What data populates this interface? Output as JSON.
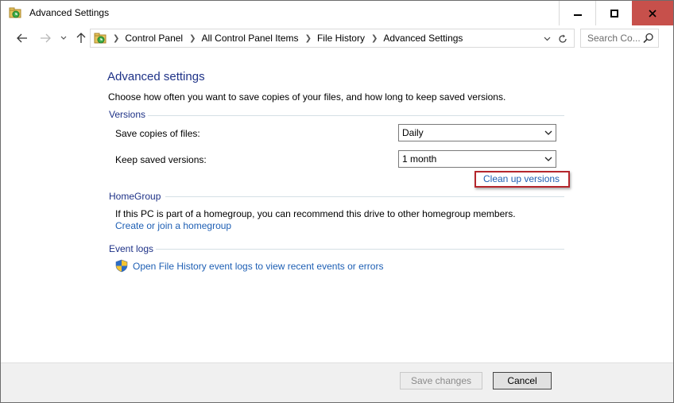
{
  "window": {
    "title": "Advanced Settings"
  },
  "address_bar": {
    "crumbs": [
      "Control Panel",
      "All Control Panel Items",
      "File History",
      "Advanced Settings"
    ]
  },
  "search": {
    "placeholder": "Search Co..."
  },
  "main": {
    "heading": "Advanced settings",
    "description": "Choose how often you want to save copies of your files, and how long to keep saved versions.",
    "versions": {
      "label": "Versions",
      "save_copies_label": "Save copies of files:",
      "save_copies_value": "Daily",
      "keep_versions_label": "Keep saved versions:",
      "keep_versions_value": "1 month",
      "cleanup_link": "Clean up versions"
    },
    "homegroup": {
      "label": "HomeGroup",
      "text": "If this PC is part of a homegroup, you can recommend this drive to other homegroup members.",
      "link": "Create or join a homegroup"
    },
    "event_logs": {
      "label": "Event logs",
      "link": "Open File History event logs to view recent events or errors"
    }
  },
  "footer": {
    "save_label": "Save changes",
    "cancel_label": "Cancel"
  },
  "colors": {
    "heading": "#1e3287",
    "link": "#1e5fb4",
    "highlight_box": "#b5262c",
    "close_button": "#c7504b"
  },
  "icons": [
    "file-history-icon",
    "back-arrow-icon",
    "forward-arrow-icon",
    "recent-dropdown-icon",
    "up-arrow-icon",
    "refresh-icon",
    "search-icon",
    "chevron-down-icon",
    "uac-shield-icon",
    "minimize-icon",
    "maximize-icon",
    "close-icon"
  ]
}
